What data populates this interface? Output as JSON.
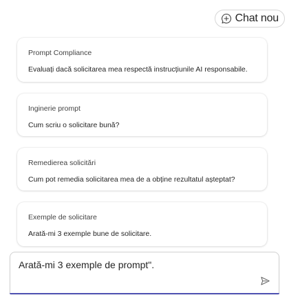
{
  "header": {
    "new_chat_label": "Chat nou"
  },
  "suggestions": [
    {
      "title": "Prompt Compliance",
      "text": "Evaluați dacă solicitarea mea respectă instrucțiunile AI responsabile."
    },
    {
      "title": "Inginerie prompt",
      "text": "Cum scriu o solicitare bună?"
    },
    {
      "title": "Remedierea solicitări",
      "text": "Cum pot remedia solicitarea mea de a obține rezultatul așteptat?"
    },
    {
      "title": "Exemple de solicitare",
      "text": "Arată-mi 3 exemple bune de solicitare."
    }
  ],
  "composer": {
    "value": "Arată-mi 3 exemple de prompt\"."
  },
  "icons": {
    "new_chat": "chat-add-icon",
    "send": "send-icon"
  },
  "colors": {
    "accent_underline": "#4f52b2"
  }
}
